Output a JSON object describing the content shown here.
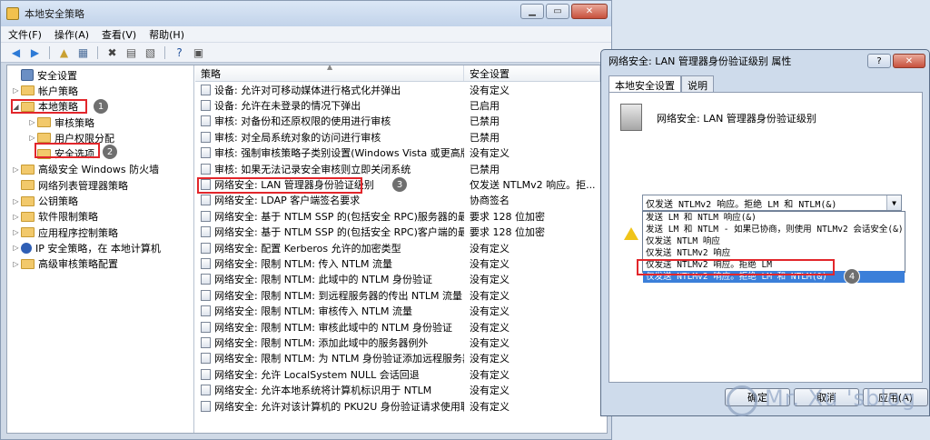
{
  "main_window": {
    "title": "本地安全策略",
    "menu": [
      "文件(F)",
      "操作(A)",
      "查看(V)",
      "帮助(H)"
    ]
  },
  "tree": {
    "items": [
      {
        "label": "安全设置",
        "level": 0,
        "expander": ""
      },
      {
        "label": "帐户策略",
        "level": 1,
        "expander": "▷"
      },
      {
        "label": "本地策略",
        "level": 1,
        "expander": "◢"
      },
      {
        "label": "审核策略",
        "level": 2,
        "expander": "▷"
      },
      {
        "label": "用户权限分配",
        "level": 2,
        "expander": "▷"
      },
      {
        "label": "安全选项",
        "level": 2,
        "expander": ""
      },
      {
        "label": "高级安全 Windows 防火墙",
        "level": 1,
        "expander": "▷"
      },
      {
        "label": "网络列表管理器策略",
        "level": 1,
        "expander": ""
      },
      {
        "label": "公钥策略",
        "level": 1,
        "expander": "▷"
      },
      {
        "label": "软件限制策略",
        "level": 1,
        "expander": "▷"
      },
      {
        "label": "应用程序控制策略",
        "level": 1,
        "expander": "▷"
      },
      {
        "label": "IP 安全策略，在 本地计算机",
        "level": 1,
        "expander": "▷"
      },
      {
        "label": "高级审核策略配置",
        "level": 1,
        "expander": "▷"
      }
    ]
  },
  "list": {
    "headers": {
      "policy": "策略",
      "setting": "安全设置"
    },
    "rows": [
      {
        "policy": "设备: 允许对可移动媒体进行格式化并弹出",
        "setting": "没有定义"
      },
      {
        "policy": "设备: 允许在未登录的情况下弹出",
        "setting": "已启用"
      },
      {
        "policy": "审核: 对备份和还原权限的使用进行审核",
        "setting": "已禁用"
      },
      {
        "policy": "审核: 对全局系统对象的访问进行审核",
        "setting": "已禁用"
      },
      {
        "policy": "审核: 强制审核策略子类别设置(Windows Vista 或更高版本...",
        "setting": "没有定义"
      },
      {
        "policy": "审核: 如果无法记录安全审核则立即关闭系统",
        "setting": "已禁用"
      },
      {
        "policy": "网络安全: LAN 管理器身份验证级别",
        "setting": "仅发送 NTLMv2 响应。拒..."
      },
      {
        "policy": "网络安全: LDAP 客户端签名要求",
        "setting": "协商签名"
      },
      {
        "policy": "网络安全: 基于 NTLM SSP 的(包括安全 RPC)服务器的最小...",
        "setting": "要求 128 位加密"
      },
      {
        "policy": "网络安全: 基于 NTLM SSP 的(包括安全 RPC)客户端的最小...",
        "setting": "要求 128 位加密"
      },
      {
        "policy": "网络安全: 配置 Kerberos 允许的加密类型",
        "setting": "没有定义"
      },
      {
        "policy": "网络安全: 限制 NTLM: 传入 NTLM 流量",
        "setting": "没有定义"
      },
      {
        "policy": "网络安全: 限制 NTLM: 此域中的 NTLM 身份验证",
        "setting": "没有定义"
      },
      {
        "policy": "网络安全: 限制 NTLM: 到远程服务器的传出 NTLM 流量",
        "setting": "没有定义"
      },
      {
        "policy": "网络安全: 限制 NTLM: 审核传入 NTLM 流量",
        "setting": "没有定义"
      },
      {
        "policy": "网络安全: 限制 NTLM: 审核此域中的 NTLM 身份验证",
        "setting": "没有定义"
      },
      {
        "policy": "网络安全: 限制 NTLM: 添加此域中的服务器例外",
        "setting": "没有定义"
      },
      {
        "policy": "网络安全: 限制 NTLM: 为 NTLM 身份验证添加远程服务器...",
        "setting": "没有定义"
      },
      {
        "policy": "网络安全: 允许 LocalSystem NULL 会话回退",
        "setting": "没有定义"
      },
      {
        "policy": "网络安全: 允许本地系统将计算机标识用于 NTLM",
        "setting": "没有定义"
      },
      {
        "policy": "网络安全: 允许对该计算机的 PKU2U 身份验证请求使用联...",
        "setting": "没有定义"
      }
    ]
  },
  "dialog": {
    "title": "网络安全: LAN 管理器身份验证级别 属性",
    "tabs": [
      "本地安全设置",
      "说明"
    ],
    "heading": "网络安全: LAN 管理器身份验证级别",
    "selected": "仅发送 NTLMv2 响应。拒绝 LM 和 NTLM(&)",
    "options": [
      "发送 LM 和 NTLM 响应(&)",
      "发送 LM 和 NTLM - 如果已协商，则使用 NTLMv2 会话安全(&)",
      "仅发送 NTLM 响应",
      "仅发送 NTLMv2 响应",
      "仅发送 NTLMv2 响应。拒绝 LM",
      "仅发送 NTLMv2 响应。拒绝 LM 和 NTLM(&)"
    ],
    "buttons": {
      "ok": "确定",
      "cancel": "取消",
      "apply": "应用(A)"
    },
    "help_icon": "?",
    "close_icon": "✕"
  },
  "badges": [
    "1",
    "2",
    "3",
    "4"
  ],
  "watermark": "Mr. Xu 'sblog",
  "colors": {
    "highlight_box": "#e2262b",
    "selection": "#3b7fd9"
  }
}
